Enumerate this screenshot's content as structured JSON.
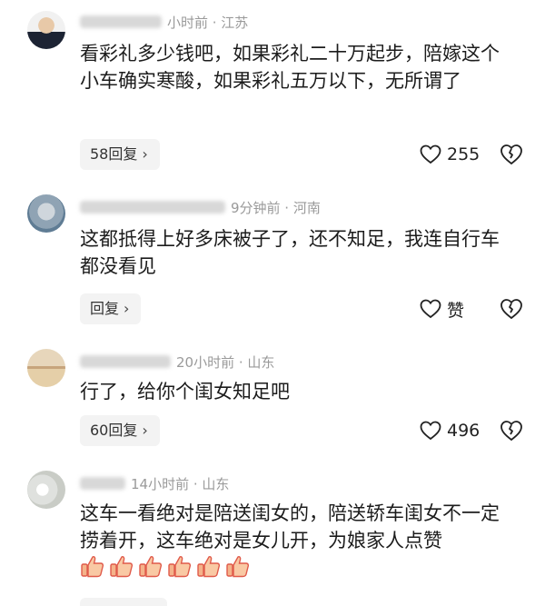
{
  "comments": [
    {
      "meta": "小时前 · 江苏",
      "text": "看彩礼多少钱吧，如果彩礼二十万起步，陪嫁这个小车确实寒酸，如果彩礼五万以下，无所谓了",
      "reply_label": "58回复",
      "likes": "255"
    },
    {
      "meta": "9分钟前 · 河南",
      "text": "这都抵得上好多床被子了，还不知足，我连自行车都没看见",
      "reply_label": "回复",
      "likes": "赞"
    },
    {
      "meta": "20小时前 · 山东",
      "text": "行了，给你个闺女知足吧",
      "reply_label": "60回复",
      "likes": "496"
    },
    {
      "meta": "14小时前 · 山东",
      "text": "这车一看绝对是陪送闺女的，陪送轿车闺女不一定捞着开，这车绝对是女儿开，为娘家人点赞",
      "thumbs_emoji": "👍👍👍👍👍👍"
    }
  ],
  "icons": {
    "like": "heart-outline-icon",
    "dislike": "broken-heart-icon",
    "chevron": "chevron-right-icon",
    "thumbs": "thumbs-up-emoji-icon"
  },
  "colors": {
    "meta": "#9a9a9a",
    "reply_bg": "#f3f3f3",
    "text": "#1c1c1c"
  }
}
